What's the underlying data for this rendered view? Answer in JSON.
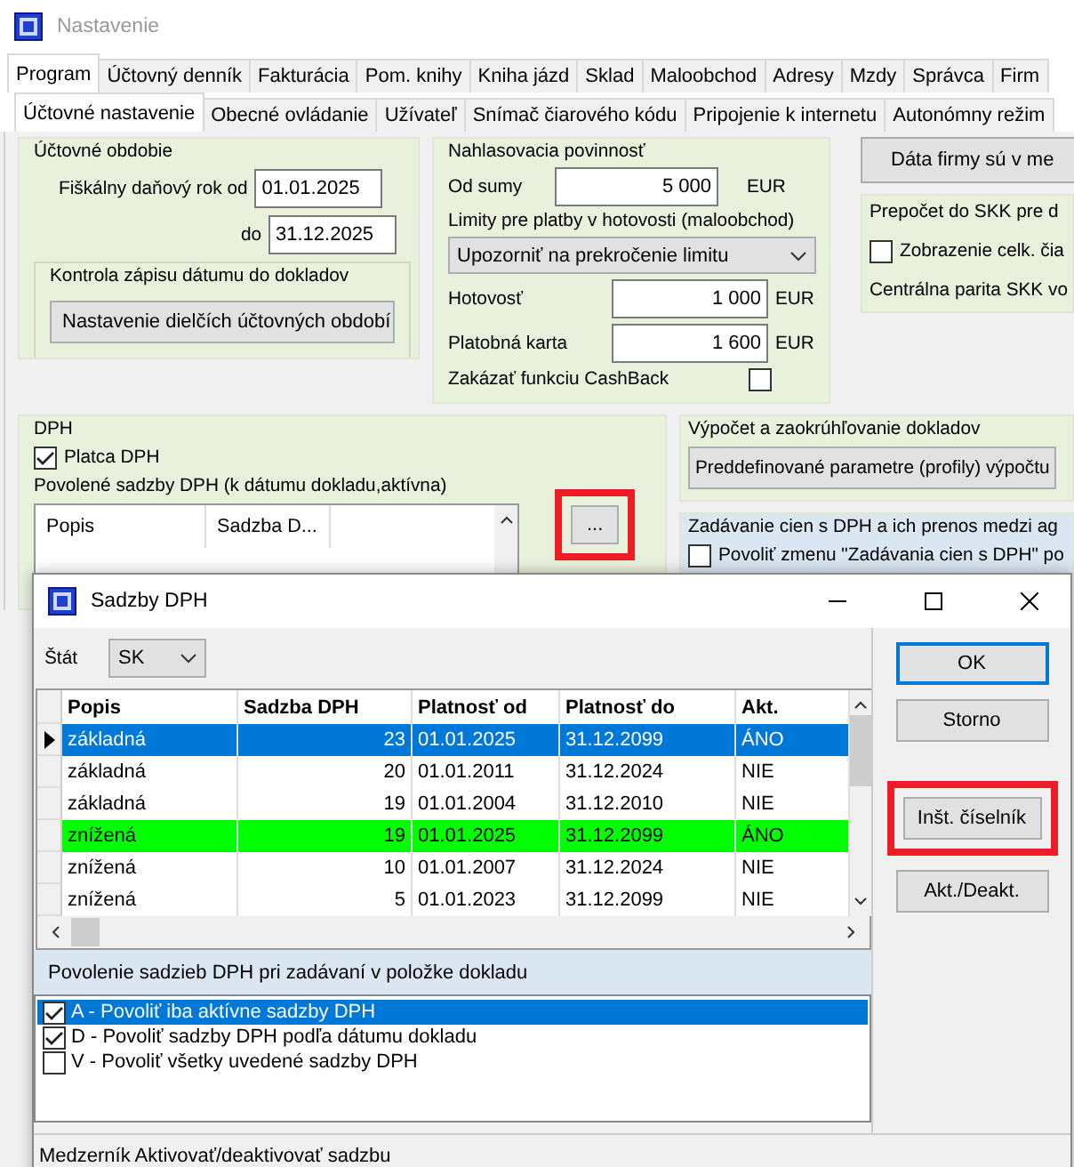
{
  "window": {
    "title": "Nastavenie"
  },
  "tabs": [
    {
      "label": "Program",
      "selected": true
    },
    {
      "label": "Účtovný denník",
      "selected": false
    },
    {
      "label": "Fakturácia",
      "selected": false
    },
    {
      "label": "Pom. knihy",
      "selected": false
    },
    {
      "label": "Kniha jázd",
      "selected": false
    },
    {
      "label": "Sklad",
      "selected": false
    },
    {
      "label": "Maloobchod",
      "selected": false
    },
    {
      "label": "Adresy",
      "selected": false
    },
    {
      "label": "Mzdy",
      "selected": false
    },
    {
      "label": "Správca",
      "selected": false
    },
    {
      "label": "Firm",
      "selected": false
    }
  ],
  "subtabs": [
    {
      "label": "Účtovné nastavenie",
      "selected": true
    },
    {
      "label": "Obecné ovládanie",
      "selected": false
    },
    {
      "label": "Užívateľ",
      "selected": false
    },
    {
      "label": "Snímač čiarového kódu",
      "selected": false
    },
    {
      "label": "Pripojenie k internetu",
      "selected": false
    },
    {
      "label": "Autonómny režim",
      "selected": false
    }
  ],
  "period": {
    "title": "Účtovné obdobie",
    "from_label": "Fiškálny daňový rok od",
    "from": "01.01.2025",
    "to_label": "do",
    "to": "31.12.2025",
    "control_title": "Kontrola zápisu dátumu do dokladov",
    "control_button": "Nastavenie dielčích účtovných období"
  },
  "reporting": {
    "title": "Nahlasovacia povinnosť",
    "sum_label": "Od sumy",
    "sum": "5 000",
    "sum_unit": "EUR",
    "limits_label": "Limity pre platby v hotovosti (maloobchod)",
    "limits_select": "Upozorniť na prekročenie limitu",
    "cash_label": "Hotovosť",
    "cash": "1 000",
    "cash_unit": "EUR",
    "card_label": "Platobná karta",
    "card": "1 600",
    "card_unit": "EUR",
    "cashback_label": "Zakázať funkciu CashBack",
    "cashback_checked": false
  },
  "company_button": "Dáta firmy sú v me",
  "skk": {
    "title": "Prepočet do SKK pre d",
    "checkbox_label": "Zobrazenie celk. čia",
    "checked": false,
    "note": "Centrálna parita SKK vo"
  },
  "vat": {
    "title": "DPH",
    "payer_label": "Platca DPH",
    "payer_checked": true,
    "rates_label": "Povolené sadzby DPH (k dátumu dokladu,aktívna)",
    "columns": [
      "Popis",
      "Sadzba D..."
    ],
    "more_button": {
      "label": "...",
      "highlighted": true
    }
  },
  "calc": {
    "title": "Výpočet a zaokrúhľovanie dokladov",
    "button": "Preddefinované parametre (profily) výpočtu"
  },
  "prices": {
    "title": "Zadávanie cien s DPH a ich prenos medzi ag",
    "checkbox_label": "Povoliť zmenu \"Zadávania cien s DPH\" po",
    "checked": false
  },
  "dialog": {
    "title": "Sadzby DPH",
    "country_label": "Štát",
    "country": "SK",
    "columns": [
      "Popis",
      "Sadzba DPH",
      "Platnosť od",
      "Platnosť do",
      "Akt."
    ],
    "rows": [
      {
        "cells": [
          "základná",
          "23",
          "01.01.2025",
          "31.12.2099",
          "ÁNO"
        ],
        "selected": true,
        "highlighted": false
      },
      {
        "cells": [
          "základná",
          "20",
          "01.01.2011",
          "31.12.2024",
          "NIE"
        ],
        "selected": false,
        "highlighted": false
      },
      {
        "cells": [
          "základná",
          "19",
          "01.01.2004",
          "31.12.2010",
          "NIE"
        ],
        "selected": false,
        "highlighted": false
      },
      {
        "cells": [
          "znížená",
          "19",
          "01.01.2025",
          "31.12.2099",
          "ÁNO"
        ],
        "selected": false,
        "highlighted": true
      },
      {
        "cells": [
          "znížená",
          "10",
          "01.01.2007",
          "31.12.2024",
          "NIE"
        ],
        "selected": false,
        "highlighted": false
      },
      {
        "cells": [
          "znížená",
          "5",
          "01.01.2023",
          "31.12.2099",
          "NIE"
        ],
        "selected": false,
        "highlighted": false
      }
    ],
    "options_title": "Povolenie sadzieb DPH pri zadávaní v položke dokladu",
    "options": [
      {
        "label": "A - Povoliť iba aktívne sadzby DPH",
        "checked": true,
        "selected": true
      },
      {
        "label": "D - Povoliť sadzby DPH podľa dátumu dokladu",
        "checked": true,
        "selected": false
      },
      {
        "label": "V - Povoliť všetky uvedené sadzby DPH",
        "checked": false,
        "selected": false
      }
    ],
    "buttons": [
      {
        "label": "OK",
        "focused": true,
        "highlighted": false
      },
      {
        "label": "Storno",
        "focused": false,
        "highlighted": false
      },
      {
        "label": "Inšt. číselník",
        "focused": false,
        "highlighted": true
      },
      {
        "label": "Akt./Deakt.",
        "focused": false,
        "highlighted": false
      }
    ],
    "status": "Medzerník Aktivovať/deaktivovať sadzbu"
  }
}
